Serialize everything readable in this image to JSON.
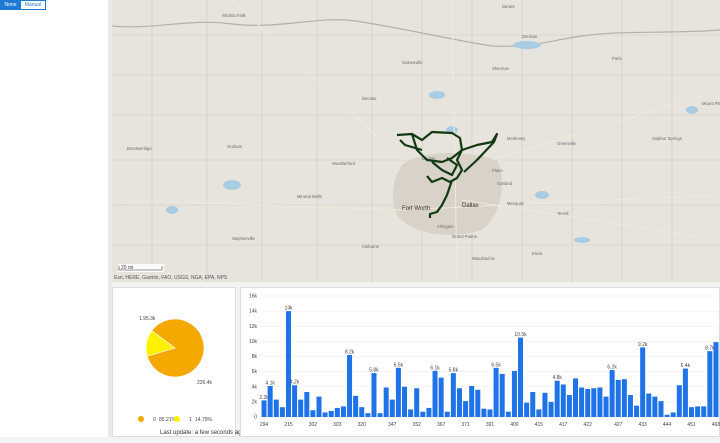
{
  "toolbar": {
    "none_label": "None",
    "manual_label": "Manual"
  },
  "map": {
    "scale_label": "20 mi",
    "attribution": "Esri, HERE, Garmin, FAO, USGS, NGA, EPA, NPS",
    "places": [
      {
        "name": "Wichita Falls"
      },
      {
        "name": "Durant"
      },
      {
        "name": "Denison"
      },
      {
        "name": "Gainesville"
      },
      {
        "name": "Sherman"
      },
      {
        "name": "Paris"
      },
      {
        "name": "Decatur"
      },
      {
        "name": "Denton"
      },
      {
        "name": "McKinney"
      },
      {
        "name": "Greenville"
      },
      {
        "name": "Graham"
      },
      {
        "name": "Weatherford"
      },
      {
        "name": "Fort Worth"
      },
      {
        "name": "Dallas"
      },
      {
        "name": "Arlington"
      },
      {
        "name": "Mesquite"
      },
      {
        "name": "Garland"
      },
      {
        "name": "Plano"
      },
      {
        "name": "Grand Prairie"
      },
      {
        "name": "Mineral Wells"
      },
      {
        "name": "Stephenville"
      },
      {
        "name": "Cleburne"
      },
      {
        "name": "Waxahachie"
      },
      {
        "name": "Ennis"
      },
      {
        "name": "Terrell"
      },
      {
        "name": "Sulphur Springs"
      },
      {
        "name": "Breckenridge"
      },
      {
        "name": "Mount Pleasant"
      }
    ],
    "route_color": "#123a12",
    "water_color": "#a9cce3",
    "urban_color": "#d9d2c8"
  },
  "pie": {
    "slices": [
      {
        "label": "0",
        "value": 85.21,
        "legend": "85.21%",
        "color": "#f5a800",
        "callout": "226.4k"
      },
      {
        "label": "1",
        "value": 14.79,
        "legend": "14.79%",
        "color": "#fff200",
        "callout": "1.95.3k"
      }
    ],
    "last_update": "Last update: a few seconds ago"
  },
  "chart_data": {
    "type": "bar",
    "color": "#1e73e8",
    "ylim": [
      0,
      16000
    ],
    "yticks": [
      "0",
      "2k",
      "4k",
      "6k",
      "8k",
      "10k",
      "12k",
      "14k",
      "16k"
    ],
    "values": [
      2200,
      4100,
      2300,
      1300,
      14000,
      4200,
      2300,
      3300,
      900,
      2700,
      600,
      800,
      1200,
      1400,
      8200,
      2800,
      1300,
      500,
      5800,
      500,
      3900,
      2300,
      6500,
      4000,
      1000,
      3800,
      700,
      1200,
      6100,
      5200,
      700,
      5800,
      3800,
      2100,
      4100,
      3600,
      1100,
      1000,
      6500,
      5700,
      700,
      6100,
      10500,
      1900,
      3300,
      1000,
      3200,
      2000,
      4800,
      4300,
      2900,
      5100,
      3900,
      3700,
      3800,
      3900,
      2700,
      6200,
      4900,
      5000,
      2900,
      1500,
      9200,
      3100,
      2700,
      2100,
      300,
      600,
      4200,
      6400,
      1300,
      1400,
      1400,
      8700,
      9900
    ],
    "data_labels": [
      {
        "i": 0,
        "text": "2.2k"
      },
      {
        "i": 1,
        "text": "4.1k"
      },
      {
        "i": 4,
        "text": "14k"
      },
      {
        "i": 5,
        "text": "4.2k"
      },
      {
        "i": 14,
        "text": "8.2k"
      },
      {
        "i": 18,
        "text": "5.8k"
      },
      {
        "i": 22,
        "text": "6.5k"
      },
      {
        "i": 28,
        "text": "6.1k"
      },
      {
        "i": 31,
        "text": "5.8k"
      },
      {
        "i": 38,
        "text": "6.5k"
      },
      {
        "i": 42,
        "text": "10.5k"
      },
      {
        "i": 48,
        "text": "4.8k"
      },
      {
        "i": 57,
        "text": "6.2k"
      },
      {
        "i": 62,
        "text": "9.2k"
      },
      {
        "i": 69,
        "text": "6.4k"
      },
      {
        "i": 73,
        "text": "8.7k"
      }
    ],
    "xlabels": [
      "294",
      "215",
      "302",
      "303",
      "320",
      "347",
      "352",
      "367",
      "371",
      "391",
      "400",
      "415",
      "417",
      "422",
      "427",
      "433",
      "444",
      "451",
      "468"
    ]
  }
}
